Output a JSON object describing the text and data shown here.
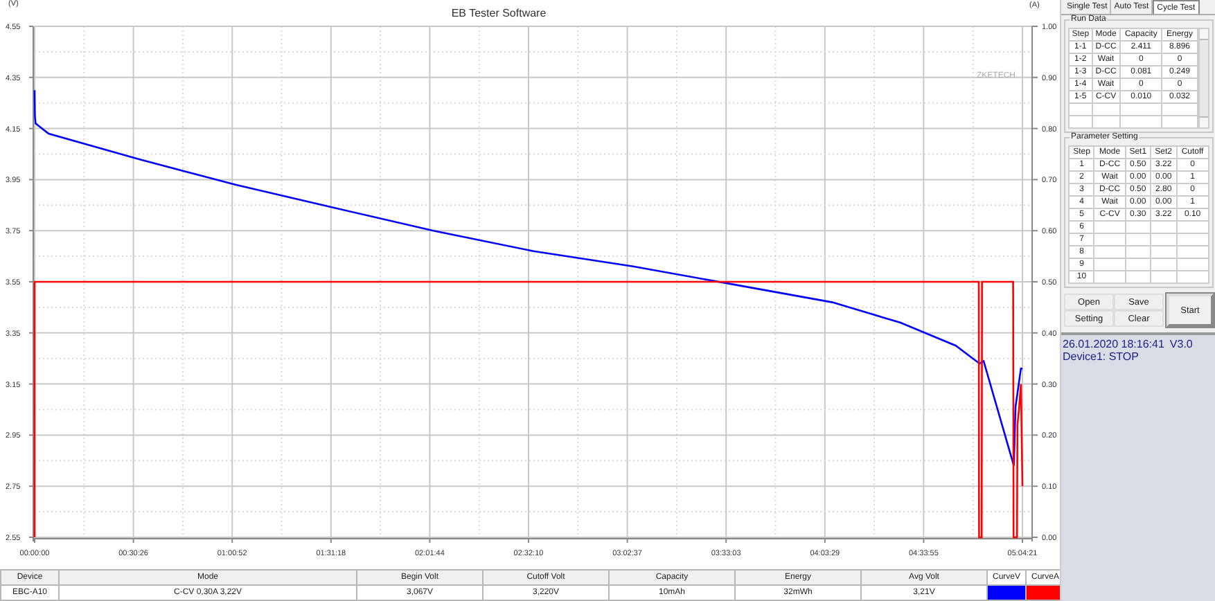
{
  "chart": {
    "chart_data": {
      "type": "line",
      "grid": true,
      "title": "EB Tester Software",
      "ylabel": "(V)",
      "y2label": "(A)",
      "xlim": [
        0,
        304.35
      ],
      "ylim": [
        2.55,
        4.55
      ],
      "y2lim": [
        0,
        1
      ],
      "xticks": [
        {
          "value": 0,
          "label": "00:00:00"
        },
        {
          "value": 30.435,
          "label": "00:30:26"
        },
        {
          "value": 60.87,
          "label": "01:00:52"
        },
        {
          "value": 91.305,
          "label": "01:31:18"
        },
        {
          "value": 121.74,
          "label": "02:01:44"
        },
        {
          "value": 152.175,
          "label": "02:32:10"
        },
        {
          "value": 182.61,
          "label": "03:02:37"
        },
        {
          "value": 213.045,
          "label": "03:33:03"
        },
        {
          "value": 243.48,
          "label": "04:03:29"
        },
        {
          "value": 273.915,
          "label": "04:33:55"
        },
        {
          "value": 304.35,
          "label": "05:04:21"
        }
      ],
      "yticks": [
        {
          "value": 2.55,
          "label": "2.55"
        },
        {
          "value": 2.75,
          "label": "2.75"
        },
        {
          "value": 2.95,
          "label": "2.95"
        },
        {
          "value": 3.15,
          "label": "3.15"
        },
        {
          "value": 3.35,
          "label": "3.35"
        },
        {
          "value": 3.55,
          "label": "3.55"
        },
        {
          "value": 3.75,
          "label": "3.75"
        },
        {
          "value": 3.95,
          "label": "3.95"
        },
        {
          "value": 4.15,
          "label": "4.15"
        },
        {
          "value": 4.35,
          "label": "4.35"
        },
        {
          "value": 4.55,
          "label": "4.55"
        }
      ],
      "y2ticks": [
        {
          "value": 0,
          "label": "0.00"
        },
        {
          "value": 0.1,
          "label": "0.10"
        },
        {
          "value": 0.2,
          "label": "0.20"
        },
        {
          "value": 0.3,
          "label": "0.30"
        },
        {
          "value": 0.4,
          "label": "0.40"
        },
        {
          "value": 0.5,
          "label": "0.50"
        },
        {
          "value": 0.6,
          "label": "0.60"
        },
        {
          "value": 0.7,
          "label": "0.70"
        },
        {
          "value": 0.8,
          "label": "0.80"
        },
        {
          "value": 0.9,
          "label": "0.90"
        },
        {
          "value": 1,
          "label": "1.00"
        }
      ],
      "series": [
        {
          "name": "CurveV",
          "color": "#0000ff",
          "x": [
            0,
            0.1,
            0.3,
            4.3,
            32,
            61.9,
            92.2,
            122.9,
            153.7,
            184.4,
            215.1,
            245.8,
            266.8,
            283.8,
            291.1,
            292.4,
            301.7,
            302.2,
            303.9,
            304.35
          ],
          "values": [
            4.3,
            4.2,
            4.17,
            4.13,
            4.03,
            3.93,
            3.84,
            3.75,
            3.67,
            3.61,
            3.54,
            3.47,
            3.39,
            3.3,
            3.23,
            3.24,
            2.83,
            3.06,
            3.21,
            3.21
          ]
        },
        {
          "name": "CurveA",
          "color": "#ff0000",
          "axis": "y2",
          "x": [
            0,
            0,
            290.9,
            291.0,
            291.8,
            291.9,
            291.9,
            292.1,
            301.5,
            301.6,
            302.7,
            302.8,
            303.3,
            303.9,
            304.35
          ],
          "values": [
            0,
            0.5,
            0.5,
            0,
            0,
            0.42,
            0.5,
            0.5,
            0.5,
            0,
            0,
            0.22,
            0.25,
            0.3,
            0.1
          ]
        }
      ],
      "annotations": [
        {
          "text": "ZKETECH"
        }
      ]
    }
  },
  "summary": {
    "columns": [
      "Device",
      "Mode",
      "Begin Volt",
      "Cutoff Volt",
      "Capacity",
      "Energy",
      "Avg Volt"
    ],
    "row": [
      "EBC-A10",
      "C-CV 0,30A 3,22V",
      "3,067V",
      "3,220V",
      "10mAh",
      "32mWh",
      "3,21V"
    ]
  },
  "tabs": [
    {
      "label": "Single Test",
      "selected": false
    },
    {
      "label": "Auto Test",
      "selected": false
    },
    {
      "label": "Cycle Test",
      "selected": true
    }
  ],
  "run_data": {
    "title": "Run Data",
    "columns": [
      "Step",
      "Mode",
      "Capacity",
      "Energy"
    ],
    "rows": [
      [
        "1-1",
        "D-CC",
        "2.411",
        "8.896"
      ],
      [
        "1-2",
        "Wait",
        "0",
        "0"
      ],
      [
        "1-3",
        "D-CC",
        "0.081",
        "0.249"
      ],
      [
        "1-4",
        "Wait",
        "0",
        "0"
      ],
      [
        "1-5",
        "C-CV",
        "0.010",
        "0.032"
      ]
    ]
  },
  "parameter_setting": {
    "title": "Parameter Setting",
    "columns": [
      "Step",
      "Mode",
      "Set1",
      "Set2",
      "Cutoff"
    ],
    "rows": [
      [
        "1",
        "D-CC",
        "0.50",
        "3.22",
        "0"
      ],
      [
        "2",
        "Wait",
        "0.00",
        "0.00",
        "1"
      ],
      [
        "3",
        "D-CC",
        "0.50",
        "2.80",
        "0"
      ],
      [
        "4",
        "Wait",
        "0.00",
        "0.00",
        "1"
      ],
      [
        "5",
        "C-CV",
        "0.30",
        "3.22",
        "0.10"
      ],
      [
        "6"
      ],
      [
        "7"
      ],
      [
        "8"
      ],
      [
        "9"
      ],
      [
        "10"
      ]
    ]
  },
  "buttons": [
    {
      "label": "Open"
    },
    {
      "label": "Save"
    },
    {
      "label": "Setting"
    },
    {
      "label": "Clear"
    }
  ],
  "start_button": {
    "label": "Start"
  },
  "status": {
    "datetime": "26.01.2020 18:16:41",
    "version": "V3.0",
    "device": "Device1: STOP"
  }
}
